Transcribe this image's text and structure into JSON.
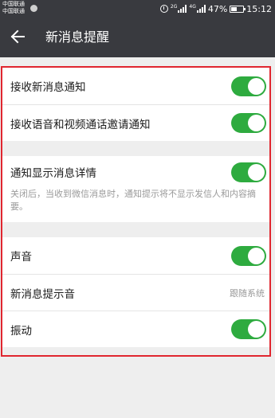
{
  "status_bar": {
    "carrier_1": "中国联通",
    "carrier_2": "中国联通",
    "net_1": "2G",
    "net_2": "4G",
    "battery": "47%",
    "time": "15:12"
  },
  "header": {
    "title": "新消息提醒",
    "back_icon": "arrow-left-icon"
  },
  "settings": {
    "group1": {
      "receive_new": {
        "label": "接收新消息通知",
        "on": true
      },
      "receive_call": {
        "label": "接收语音和视频通话邀请通知",
        "on": true
      }
    },
    "group2": {
      "show_detail": {
        "label": "通知显示消息详情",
        "on": true
      },
      "description": "关闭后，当收到微信消息时，通知提示将不显示发信人和内容摘要。"
    },
    "group3": {
      "sound": {
        "label": "声音",
        "on": true
      },
      "tone": {
        "label": "新消息提示音",
        "value": "跟随系统"
      },
      "vibrate": {
        "label": "振动",
        "on": true
      }
    }
  },
  "colors": {
    "header_bg": "#393a3f",
    "toggle_on": "#2eab3f",
    "highlight_border": "#e0262f"
  }
}
